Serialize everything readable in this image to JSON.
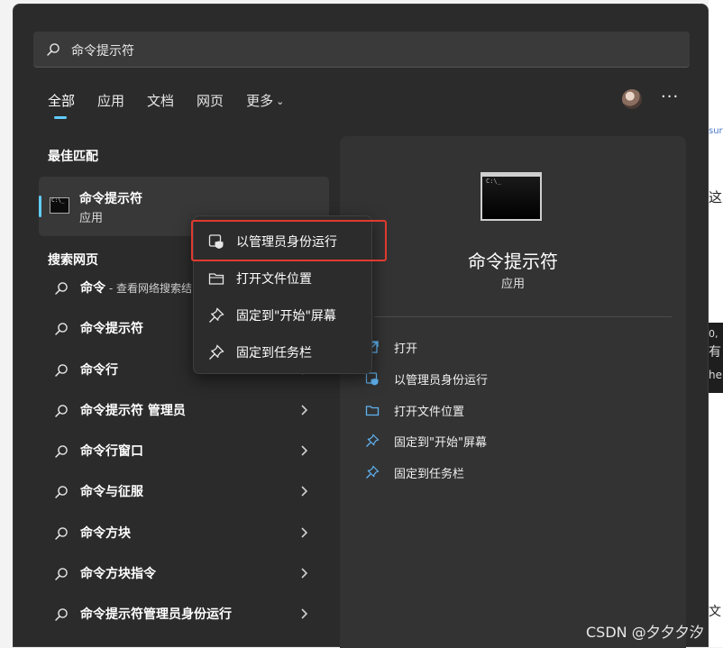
{
  "search": {
    "query": "命令提示符"
  },
  "tabs": [
    {
      "label": "全部",
      "active": true
    },
    {
      "label": "应用"
    },
    {
      "label": "文档"
    },
    {
      "label": "网页"
    },
    {
      "label": "更多"
    }
  ],
  "more_label": "···",
  "best_match": {
    "heading": "最佳匹配",
    "title": "命令提示符",
    "type": "应用"
  },
  "web": {
    "heading": "搜索网页",
    "items": [
      {
        "text": "命令",
        "sub": " - 查看网络搜索结"
      },
      {
        "text": "命令提示符"
      },
      {
        "text": "命令行"
      },
      {
        "text": "命令提示符 管理员"
      },
      {
        "text": "命令行窗口"
      },
      {
        "text": "命令与征服"
      },
      {
        "text": "命令方块"
      },
      {
        "text": "命令方块指令"
      },
      {
        "text": "命令提示符管理员身份运行"
      }
    ]
  },
  "detail": {
    "title": "命令提示符",
    "type": "应用",
    "actions": [
      {
        "label": "打开",
        "icon": "open-icon"
      },
      {
        "label": "以管理员身份运行",
        "icon": "shield-icon"
      },
      {
        "label": "打开文件位置",
        "icon": "folder-icon"
      },
      {
        "label": "固定到\"开始\"屏幕",
        "icon": "pin-icon"
      },
      {
        "label": "固定到任务栏",
        "icon": "pin-icon"
      }
    ]
  },
  "context_menu": {
    "items": [
      {
        "label": "以管理员身份运行",
        "icon": "shield-icon"
      },
      {
        "label": "打开文件位置",
        "icon": "folder-icon"
      },
      {
        "label": "固定到\"开始\"屏幕",
        "icon": "pin-icon"
      },
      {
        "label": "固定到任务栏",
        "icon": "pin-icon"
      }
    ]
  },
  "background": {
    "text1": "sur",
    "text2": "这里",
    "text3": "0,",
    "text4": "有",
    "text5": "he",
    "text6": "文"
  },
  "watermark": "CSDN @夕夕夕汐",
  "colors": {
    "accent": "#60cdff",
    "highlight_box": "#e03a2e",
    "panel": "#2b2b2b"
  }
}
